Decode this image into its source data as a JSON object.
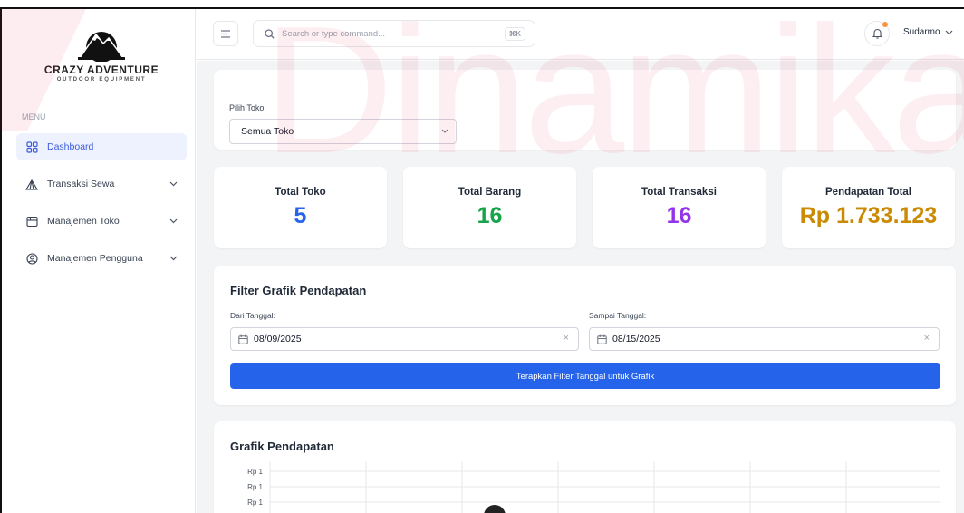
{
  "brand": {
    "title": "CRAZY ADVENTURE",
    "subtitle": "OUTDOOR EQUIPMENT"
  },
  "watermark": {
    "text": "Dinamika",
    "color": "#e11d48"
  },
  "sidebar": {
    "menu_label": "MENU",
    "items": [
      {
        "label": "Dashboard",
        "icon": "grid-icon",
        "active": true
      },
      {
        "label": "Transaksi Sewa",
        "icon": "tent-icon",
        "expandable": true
      },
      {
        "label": "Manajemen Toko",
        "icon": "store-icon",
        "expandable": true
      },
      {
        "label": "Manajemen Pengguna",
        "icon": "user-circle-icon",
        "expandable": true
      }
    ]
  },
  "header": {
    "search_placeholder": "Search or type command...",
    "shortcut": "⌘K",
    "user_name": "Sudarmo",
    "notification_dot_color": "#fb923c"
  },
  "store_filter": {
    "label": "Pilih Toko:",
    "selected": "Semua Toko"
  },
  "stats": [
    {
      "title": "Total Toko",
      "value": "5",
      "color": "#2563eb"
    },
    {
      "title": "Total Barang",
      "value": "16",
      "color": "#16a34a"
    },
    {
      "title": "Total Transaksi",
      "value": "16",
      "color": "#9333ea"
    },
    {
      "title": "Pendapatan Total",
      "value": "Rp 1.733.123",
      "color": "#ca8a04"
    }
  ],
  "date_filter": {
    "title": "Filter Grafik Pendapatan",
    "from_label": "Dari Tanggal:",
    "from_value": "08/09/2025",
    "to_label": "Sampai Tanggal:",
    "to_value": "08/15/2025",
    "apply_label": "Terapkan Filter Tanggal untuk Grafik",
    "accent": "#2563eb"
  },
  "chart": {
    "title": "Grafik Pendapatan",
    "y_ticks": [
      "Rp 1",
      "Rp 1",
      "Rp 1"
    ]
  }
}
